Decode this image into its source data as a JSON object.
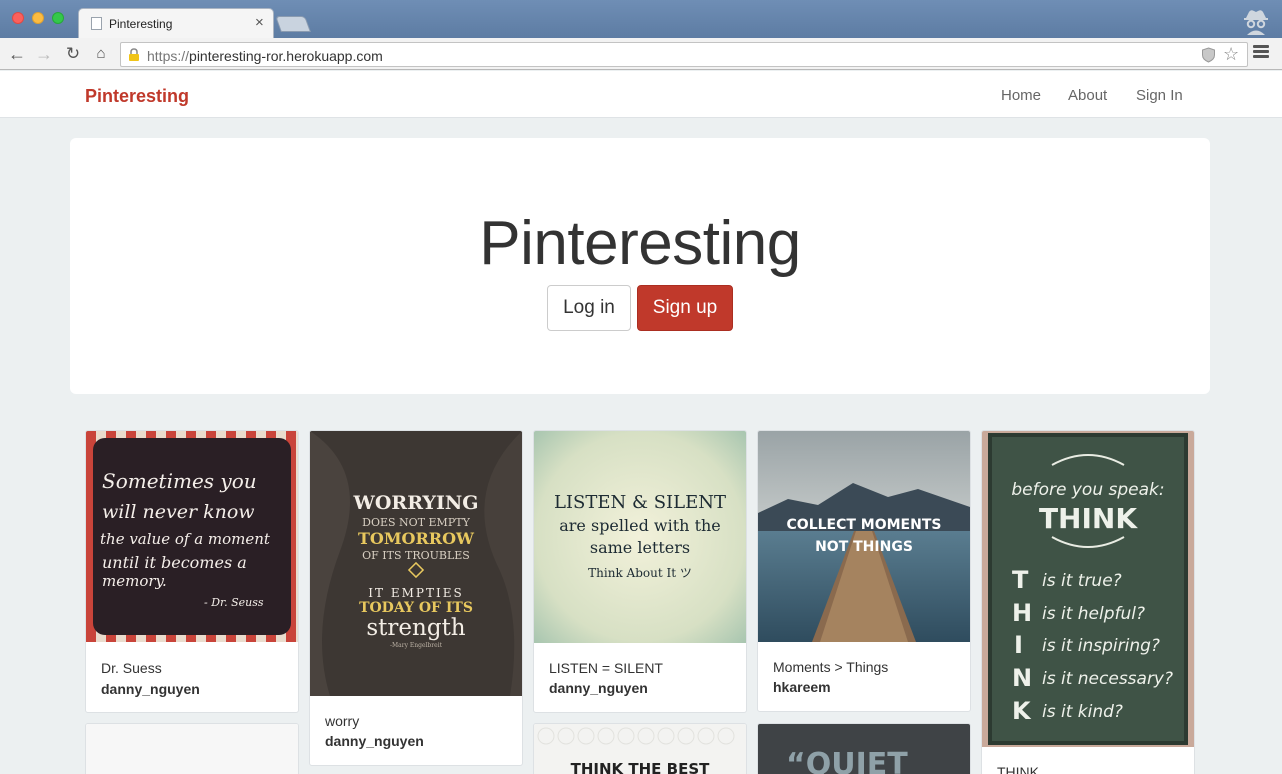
{
  "browser": {
    "tab_title": "Pinteresting",
    "url_scheme": "https://",
    "url_host": "pinteresting-ror.herokuapp.com"
  },
  "navbar": {
    "brand": "Pinteresting",
    "links": [
      "Home",
      "About",
      "Sign In"
    ]
  },
  "hero": {
    "title": "Pinteresting",
    "login_label": "Log in",
    "signup_label": "Sign up"
  },
  "pins": [
    {
      "description": "Dr. Suess",
      "user": "danny_nguyen",
      "image_text": [
        "Sometimes you",
        "will never know",
        "the value of a moment",
        "until it becomes a",
        "memory.",
        "- Dr. Seuss"
      ]
    },
    {
      "description": "worry",
      "user": "danny_nguyen",
      "image_text": [
        "WORRYING",
        "DOES NOT EMPTY",
        "TOMORROW",
        "OF ITS TROUBLES",
        "IT EMPTIES",
        "TODAY OF ITS",
        "strength",
        "-Mary Engelbreit"
      ]
    },
    {
      "description": "LISTEN = SILENT",
      "user": "danny_nguyen",
      "image_text": [
        "LISTEN & SILENT",
        "are spelled with the",
        "same letters",
        "Think About It ツ"
      ]
    },
    {
      "description": "Moments > Things",
      "user": "hkareem",
      "image_text": [
        "COLLECT MOMENTS",
        "NOT THINGS"
      ]
    },
    {
      "description": "THINK",
      "user": "",
      "image_text": [
        "before you speak:",
        "THINK",
        "is it true?",
        "is it helpful?",
        "is it inspiring?",
        "is it necessary?",
        "is it kind?",
        "T",
        "H",
        "I",
        "N",
        "K"
      ]
    },
    {
      "description": "",
      "user": "",
      "image_text": [
        "THINK THE BEST"
      ]
    },
    {
      "description": "",
      "user": "",
      "image_text": [
        "“QUIET"
      ]
    }
  ],
  "colors": {
    "brand_red": "#c0392b",
    "page_bg": "#ecf0f1"
  }
}
